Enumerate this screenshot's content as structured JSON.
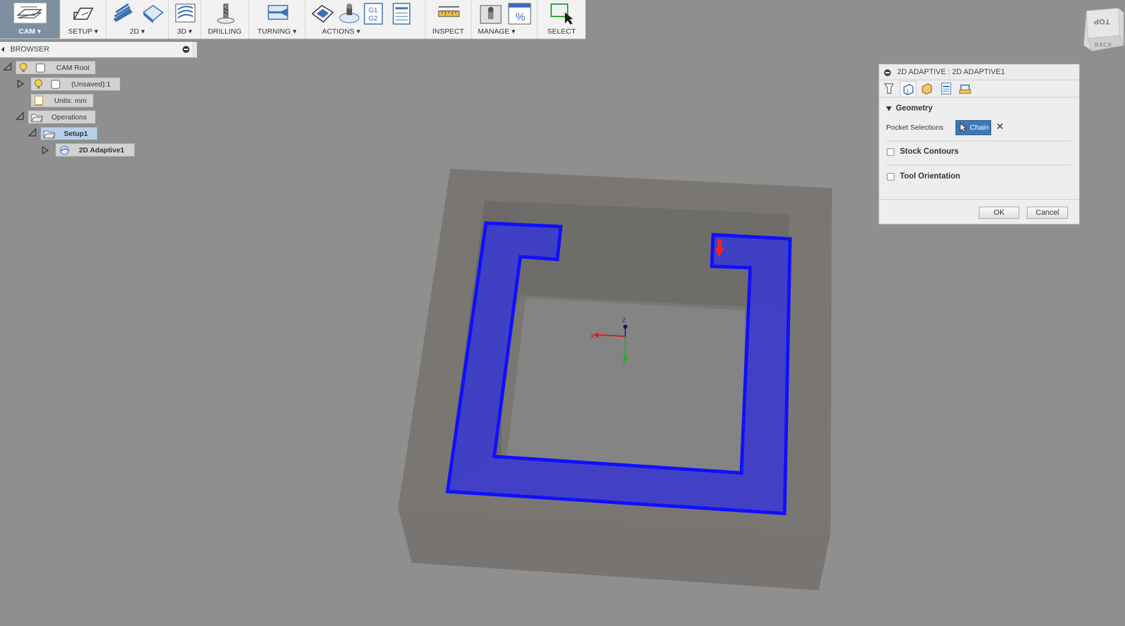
{
  "toolbar": {
    "groups": [
      {
        "label": "CAM ▾",
        "icon": "cam-workspace-icon"
      },
      {
        "label": "SETUP ▾",
        "icon": "setup-icon"
      },
      {
        "label": "2D ▾",
        "icon": "2d-adaptive-icon"
      },
      {
        "label": "3D ▾",
        "icon": "3d-adaptive-icon"
      },
      {
        "label": "DRILLING",
        "icon": "drill-icon"
      },
      {
        "label": "TURNING ▾",
        "icon": "turning-icon"
      },
      {
        "label": "ACTIONS ▾",
        "icon": "actions-icon"
      },
      {
        "label": "INSPECT",
        "icon": "measure-icon"
      },
      {
        "label": "MANAGE ▾",
        "icon": "manage-icon"
      },
      {
        "label": "SELECT",
        "icon": "select-icon"
      }
    ],
    "actions_icons": [
      "simulate-icon",
      "simulate-tool-icon",
      "post-process-icon",
      "setup-sheet-icon"
    ],
    "actions_post_text": "G1\nG2",
    "manage_percent": "%"
  },
  "browser": {
    "title": "BROWSER",
    "nodes": {
      "cam_root": "CAM Root",
      "unsaved": "(Unsaved):1",
      "units": "Units: mm",
      "operations": "Operations",
      "setup1": "Setup1",
      "adaptive1": "2D Adaptive1"
    }
  },
  "dialog": {
    "title": "2D ADAPTIVE : 2D ADAPTIVE1",
    "tabs": [
      "tool-tab-icon",
      "geometry-tab-icon",
      "heights-tab-icon",
      "passes-tab-icon",
      "linking-tab-icon"
    ],
    "active_tab": 1,
    "geometry_header": "Geometry",
    "pocket_selections_label": "Pocket Selections",
    "chain_button": "Chain",
    "clear_symbol": "✕",
    "stock_contours": {
      "label": "Stock Contours",
      "checked": false
    },
    "tool_orientation": {
      "label": "Tool Orientation",
      "checked": false
    },
    "ok": "OK",
    "cancel": "Cancel"
  },
  "viewcube": {
    "top": "TOP",
    "back": "BACK"
  },
  "triad": {
    "x": "X",
    "y": "Y",
    "z": "Z"
  },
  "colors": {
    "selection_blue": "#2222ee",
    "stock_gray": "#787571",
    "background": "#8f8f8f",
    "accent_button": "#3d78b4",
    "entry_arrow": "#ff2020"
  }
}
